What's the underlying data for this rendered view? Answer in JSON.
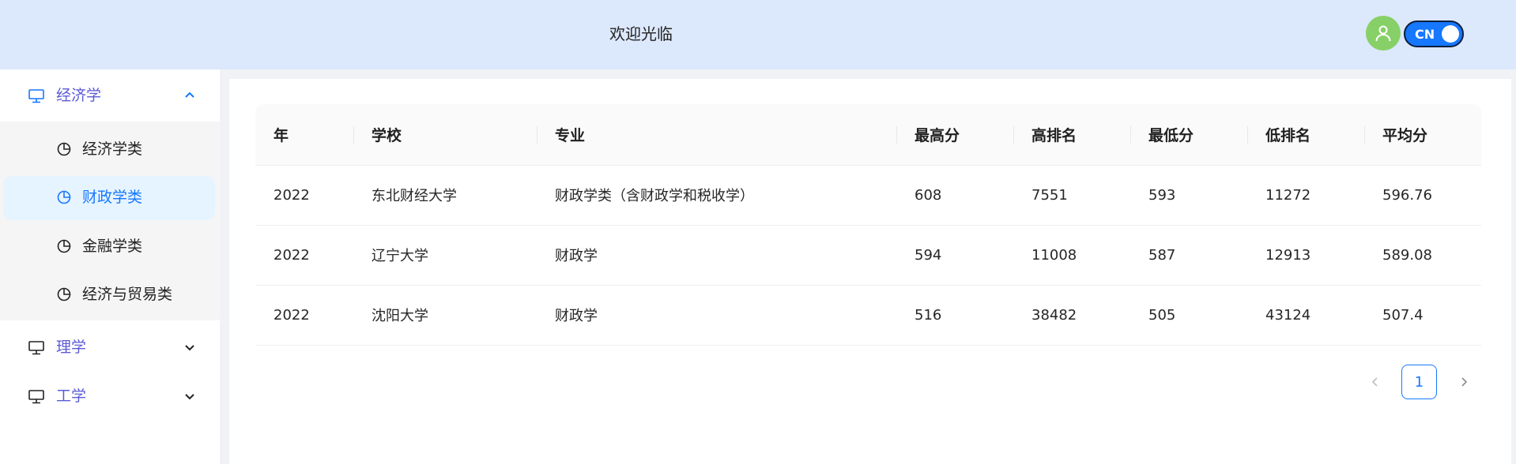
{
  "header": {
    "title": "欢迎光临",
    "lang_label": "CN"
  },
  "sidebar": {
    "groups": [
      {
        "label": "经济学",
        "expanded": true,
        "items": [
          {
            "label": "经济学类"
          },
          {
            "label": "财政学类",
            "active": true
          },
          {
            "label": "金融学类"
          },
          {
            "label": "经济与贸易类"
          }
        ]
      },
      {
        "label": "理学",
        "expanded": false
      },
      {
        "label": "工学",
        "expanded": false
      }
    ]
  },
  "table": {
    "columns": [
      "年",
      "学校",
      "专业",
      "最高分",
      "高排名",
      "最低分",
      "低排名",
      "平均分"
    ],
    "rows": [
      [
        "2022",
        "东北财经大学",
        "财政学类（含财政学和税收学）",
        "608",
        "7551",
        "593",
        "11272",
        "596.76"
      ],
      [
        "2022",
        "辽宁大学",
        "财政学",
        "594",
        "11008",
        "587",
        "12913",
        "589.08"
      ],
      [
        "2022",
        "沈阳大学",
        "财政学",
        "516",
        "38482",
        "505",
        "43124",
        "507.4"
      ]
    ]
  },
  "pagination": {
    "current_page": "1"
  },
  "colors": {
    "accent": "#1677ff",
    "header_bg": "#dce8fb",
    "avatar_bg": "#87d068",
    "menu_group_label": "#5b5bd6"
  }
}
